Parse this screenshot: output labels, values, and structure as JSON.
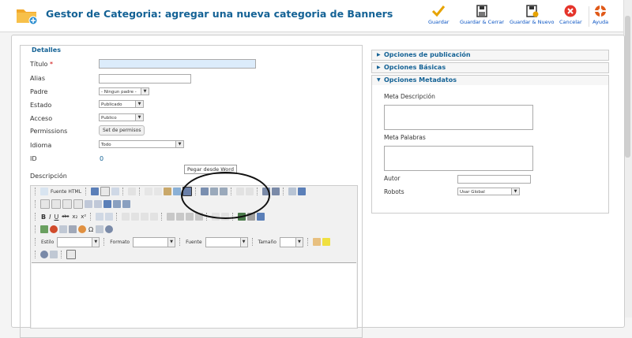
{
  "header": {
    "title": "Gestor de Categoria: agregar una nueva categoria de Banners",
    "toolbar": [
      {
        "label": "Guardar",
        "icon": "check-icon",
        "color": "#e7a300"
      },
      {
        "label": "Guardar & Cerrar",
        "icon": "save-close-icon",
        "color": "#333333"
      },
      {
        "label": "Guardar & Nuevo",
        "icon": "save-new-icon",
        "color": "#333333"
      },
      {
        "label": "Cancelar",
        "icon": "cancel-icon",
        "color": "#e5342b"
      },
      {
        "label": "Ayuda",
        "icon": "help-lifebuoy-icon",
        "color": "#e05a1a"
      }
    ]
  },
  "details": {
    "legend": "Detalles",
    "title_label": "Título",
    "required_mark": "*",
    "alias_label": "Alias",
    "parent_label": "Padre",
    "parent_value": "- Ningun padre -",
    "state_label": "Estado",
    "state_value": "Publicado",
    "access_label": "Acceso",
    "access_value": "Publico",
    "permissions_label": "Permissions",
    "permissions_button": "Set de permisos",
    "language_label": "Idioma",
    "language_value": "Todo",
    "id_label": "ID",
    "id_value": "0",
    "description_label": "Descripción"
  },
  "editor": {
    "source_html": "Fuente HTML",
    "style_label": "Estilo",
    "format_label": "Formato",
    "font_label": "Fuente",
    "size_label": "Tamaño",
    "bold": "B",
    "italic": "I",
    "underline": "U",
    "strike": "abc",
    "subscript": "x₂",
    "superscript": "x²",
    "omega": "Ω",
    "tooltip": "Pegar desde Word"
  },
  "right_panels": {
    "publication": "Opciones de publicación",
    "basic": "Opciones Básicas",
    "metadata": "Opciones Metadatos",
    "meta_description_label": "Meta Descripción",
    "meta_keywords_label": "Meta Palabras",
    "author_label": "Autor",
    "robots_label": "Robots",
    "robots_value": "Usar Global"
  },
  "colors": {
    "title_blue": "#146295",
    "link_blue": "#0b55c4",
    "title_field_bg": "#dcecfb"
  }
}
